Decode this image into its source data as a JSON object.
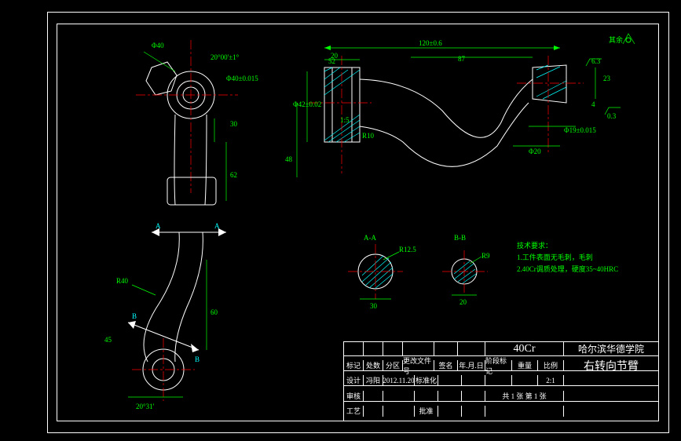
{
  "drawing": {
    "material": "40Cr",
    "school": "哈尔滨华德学院",
    "title": "右转向节臂",
    "notes_header": "技术要求：",
    "note1": "1.工件表面无毛刺，毛刺",
    "note2": "2.40Cr调质处理，硬度35~40HRC",
    "surface_symbol": "其余",
    "date": "2012.11.20"
  },
  "dimensions": {
    "top_main": "120±0.6",
    "dia_40": "Φ40",
    "angle_top": "20°00'±1°",
    "tol1": "Φ40±0.015",
    "left_30": "30",
    "left_62": "62",
    "left_r40": "R40",
    "left_45": "45",
    "left_angle": "20°31'",
    "left_60": "60",
    "secA": "A",
    "secB": "B",
    "right_52": "52",
    "right_20": "20",
    "right_87": "87",
    "right_63": "6.3",
    "right_4": "4",
    "right_03": "0.3",
    "right_dia19": "Φ19±0.015",
    "right_dia20": "Φ20",
    "right_23": "23",
    "right_dia42": "Φ42±0.02",
    "right_13": "1:5",
    "right_48": "48",
    "right_ra": "Ra6.3",
    "right_r10": "R10",
    "secAA": "A-A",
    "secBB": "B-B",
    "r125": "R12.5",
    "r9": "R9",
    "d30": "30",
    "d20": "20"
  },
  "titleblock": {
    "h_mark": "标记",
    "h_count": "处数",
    "h_zone": "分区",
    "h_doc": "更改文件号",
    "h_sign": "签名",
    "h_date": "年.月.日",
    "r_design": "设计",
    "r_design_name": "冯阳",
    "r_check": "审核",
    "r_process": "工艺",
    "r_approve": "批准",
    "r_std": "标准化",
    "stage": "阶段标记",
    "weight": "重量",
    "scale": "比例",
    "scale_val": "2:1",
    "sheets": "共 1 张  第 1 张"
  }
}
